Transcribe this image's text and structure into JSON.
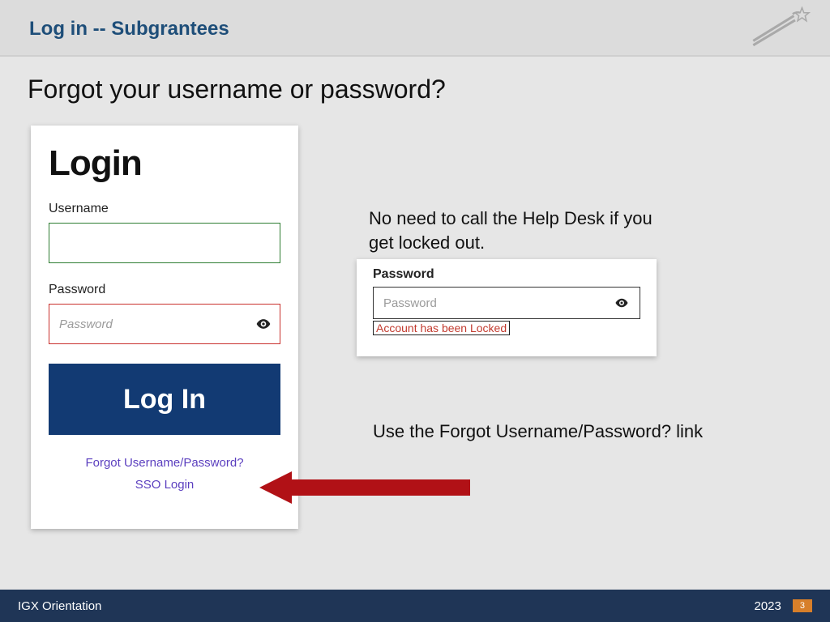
{
  "header": {
    "title": "Log in -- Subgrantees"
  },
  "heading": "Forgot your username or password?",
  "login": {
    "title": "Login",
    "username_label": "Username",
    "username_value": "",
    "password_label": "Password",
    "password_placeholder": "Password",
    "button_label": "Log In",
    "forgot_link": "Forgot Username/Password?",
    "sso_link": "SSO Login"
  },
  "help": {
    "text1": "No need to call the Help Desk if you get locked out.",
    "text2": "Use the Forgot Username/Password? link"
  },
  "lock_inset": {
    "label": "Password",
    "placeholder": "Password",
    "message": "Account has been Locked"
  },
  "footer": {
    "left": "IGX Orientation",
    "year": "2023",
    "page": "3"
  }
}
